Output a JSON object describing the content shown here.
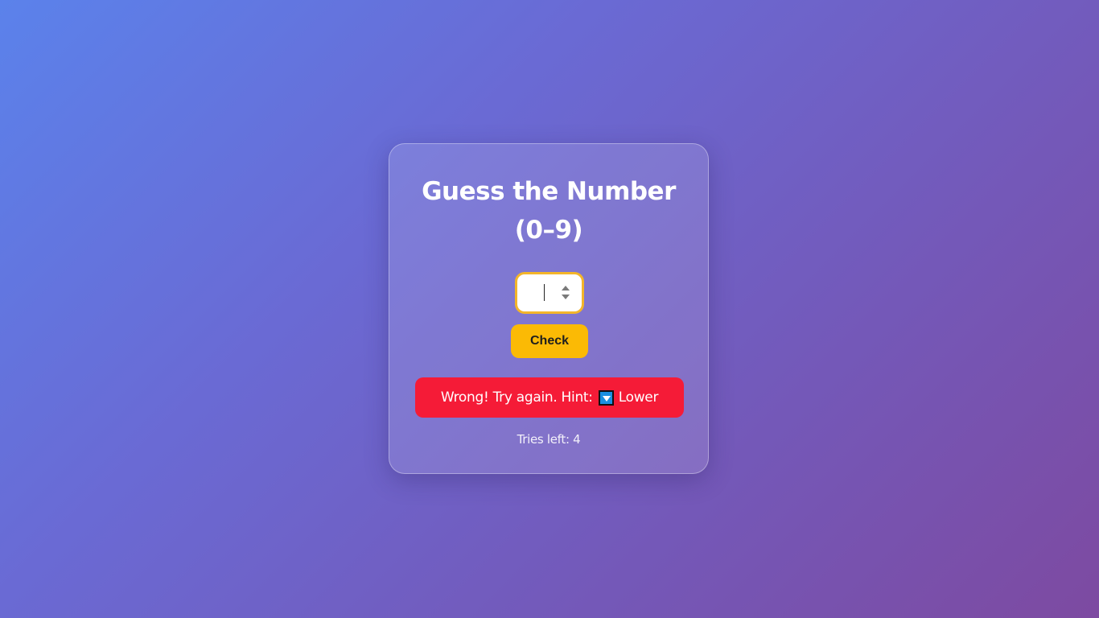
{
  "game": {
    "title_line1": "Guess the Number",
    "title_line2": "(0–9)",
    "input_value": "",
    "check_label": "Check",
    "message_prefix": "Wrong! Try again. Hint:",
    "message_hint_icon": "down-arrow-icon",
    "message_hint_label": "Lower",
    "tries_text": "Tries left: 4"
  },
  "colors": {
    "background_start": "#5b82eb",
    "background_end": "#7d4aa1",
    "button_bg": "#fbba05",
    "input_border": "#f3b52a",
    "error_bg": "#f51b37",
    "hint_icon_bg": "#1a8fe0"
  }
}
